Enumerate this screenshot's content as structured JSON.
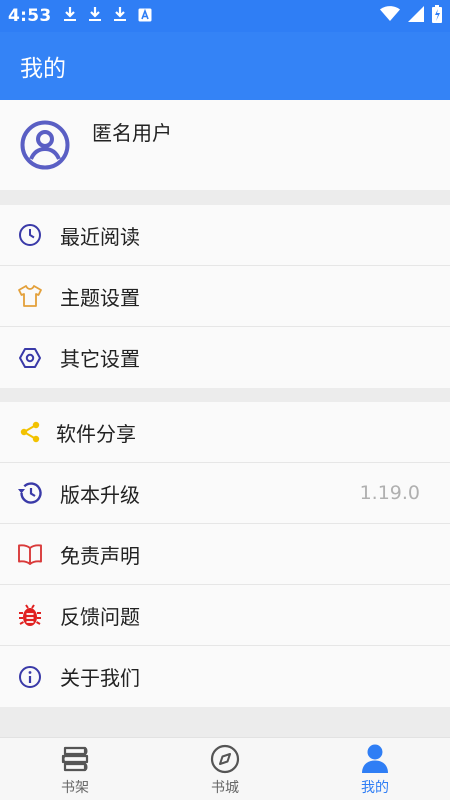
{
  "status_bar": {
    "time": "4:53",
    "left_icons": [
      "download-icon",
      "download-icon",
      "download-icon",
      "a-box-icon"
    ],
    "right_icons": [
      "wifi-icon",
      "cellular-icon",
      "battery-charging-icon"
    ]
  },
  "header": {
    "title": "我的"
  },
  "profile": {
    "username": "匿名用户",
    "avatar_icon": "user-avatar-icon"
  },
  "menu_group_1": [
    {
      "label": "最近阅读",
      "icon": "clock-icon",
      "color": "#3a3aa8"
    },
    {
      "label": "主题设置",
      "icon": "tshirt-icon",
      "color": "#e3a03a"
    },
    {
      "label": "其它设置",
      "icon": "hexagon-settings-icon",
      "color": "#3a3aa8"
    }
  ],
  "menu_group_2": [
    {
      "label": "软件分享",
      "icon": "share-icon",
      "color": "#f2c200"
    },
    {
      "label": "版本升级",
      "icon": "history-update-icon",
      "color": "#3a3aa8",
      "value": "1.19.0"
    },
    {
      "label": "免责声明",
      "icon": "open-book-icon",
      "color": "#d93a3a"
    },
    {
      "label": "反馈问题",
      "icon": "bug-icon",
      "color": "#e02020"
    },
    {
      "label": "关于我们",
      "icon": "info-icon",
      "color": "#3a3aa8"
    }
  ],
  "bottom_nav": [
    {
      "label": "书架",
      "icon": "bookshelf-icon",
      "active": false
    },
    {
      "label": "书城",
      "icon": "compass-icon",
      "active": false
    },
    {
      "label": "我的",
      "icon": "person-icon",
      "active": true
    }
  ],
  "colors": {
    "primary": "#3483f6",
    "status_bar": "#2f7ef5",
    "avatar": "#5a5fc4"
  }
}
